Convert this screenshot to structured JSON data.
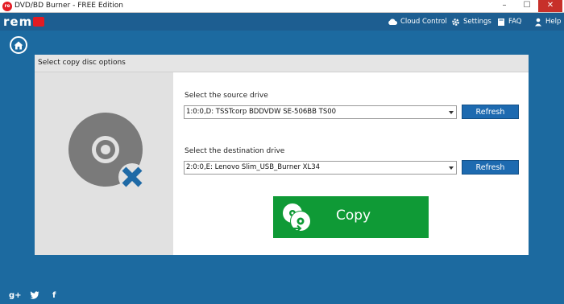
{
  "window": {
    "title": "DVD/BD Burner - FREE Edition",
    "app_icon_text": "re",
    "minimize": "–",
    "maximize": "☐",
    "close": "✕"
  },
  "brand": {
    "logo_text_prefix": "rem",
    "logo_color": "#e31b23"
  },
  "nav": {
    "cloud": "Cloud Control",
    "settings": "Settings",
    "faq": "FAQ",
    "help": "Help"
  },
  "panel": {
    "header": "Select copy disc options",
    "source_label": "Select the source drive",
    "source_value": "1:0:0,D: TSSTcorp BDDVDW SE-506BB  TS00",
    "destination_label": "Select the destination drive",
    "destination_value": "2:0:0,E: Lenovo    Slim_USB_Burner  XL34",
    "refresh_label": "Refresh",
    "copy_label": "Copy"
  },
  "social": {
    "gplus": "g+",
    "twitter": "twitter-icon",
    "facebook": "f"
  },
  "colors": {
    "background": "#1c6aa0",
    "topbar": "#1d5e91",
    "refresh_button": "#1d6ab0",
    "copy_button": "#0f9a36",
    "disc_x": "#1f6aa6"
  }
}
